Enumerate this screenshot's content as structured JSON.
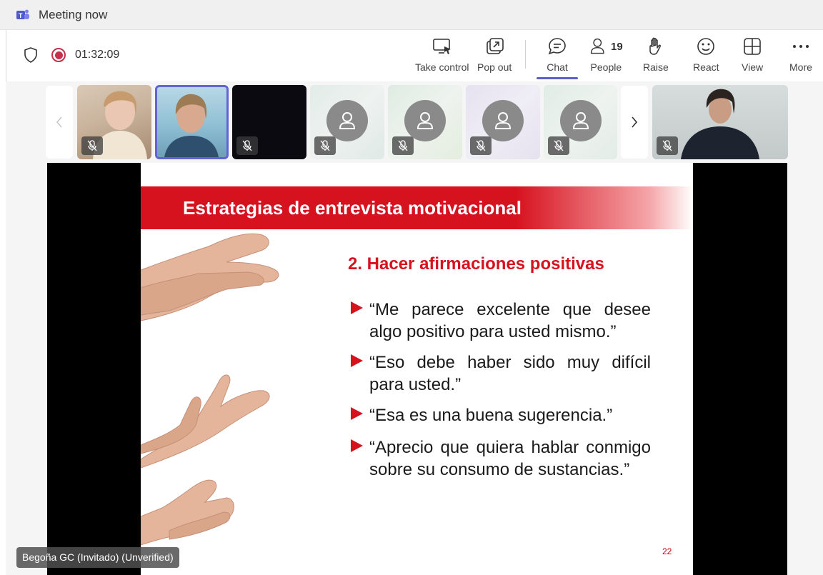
{
  "window": {
    "title": "Meeting now"
  },
  "controls": {
    "timer": "01:32:09",
    "take_control": "Take control",
    "pop_out": "Pop out",
    "chat": "Chat",
    "people": "People",
    "people_count": "19",
    "raise": "Raise",
    "react": "React",
    "view": "View",
    "more": "More"
  },
  "slide": {
    "title": "Estrategias de entrevista motivacional",
    "subtitle": "2. Hacer afirmaciones positivas",
    "bullets": [
      "“Me parece excelente que desee algo positivo para usted mismo.”",
      "“Eso debe haber sido muy difícil para usted.”",
      "“Esa es una buena sugerencia.”",
      "“Aprecio que quiera hablar conmigo sobre su consumo de sustancias.”"
    ],
    "page_number": "22"
  },
  "presenter": {
    "name": "Begoña GC (Invitado) (Unverified)"
  },
  "colors": {
    "accent": "#5b5fc7",
    "slide_red": "#d7121f",
    "record": "#c4314b"
  }
}
